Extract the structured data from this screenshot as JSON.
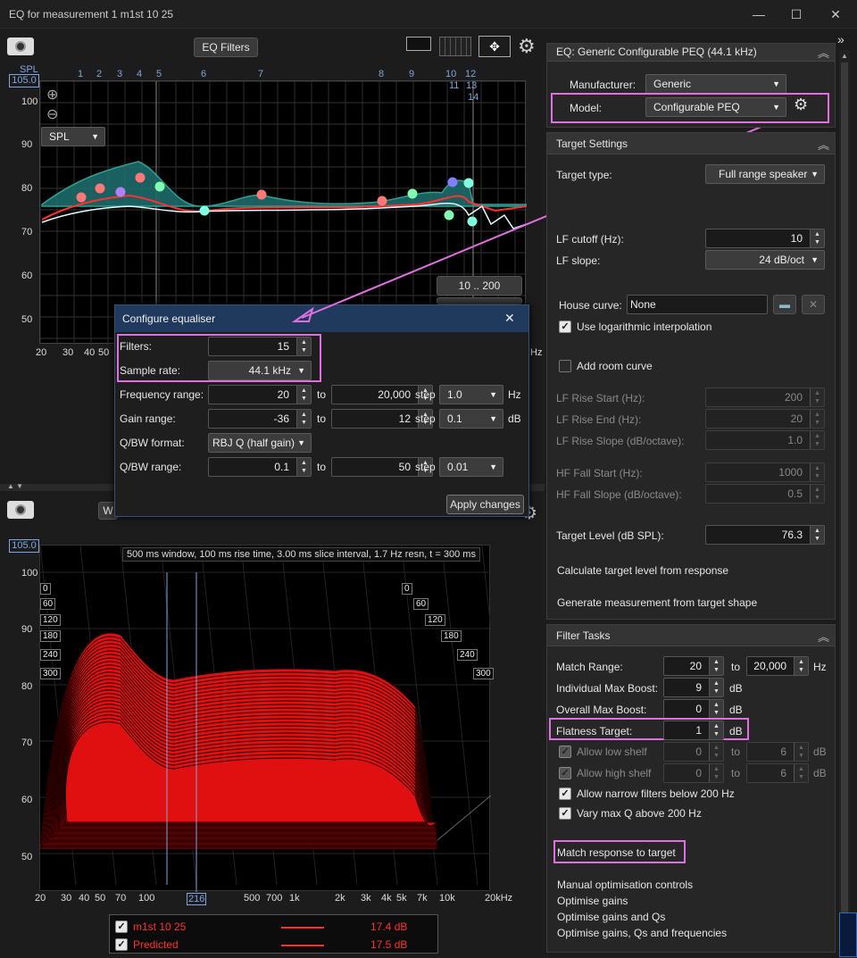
{
  "window": {
    "title": "EQ for measurement 1 m1st 10 25",
    "minimize": "—",
    "maximize": "☐",
    "close": "✕"
  },
  "top_toolbar": {
    "eq_filters_label": "EQ Filters"
  },
  "upper_chart": {
    "top_value": "105.0",
    "y_axis_label": "SPL",
    "y_ticks": [
      "100",
      "90",
      "80",
      "70",
      "60",
      "50"
    ],
    "x_ticks": [
      "20",
      "30",
      "40",
      "50"
    ],
    "filter_numbers": [
      "1",
      "2",
      "3",
      "4",
      "5",
      "6",
      "7",
      "8",
      "9",
      "10",
      "11",
      "12",
      "13",
      "14"
    ],
    "spl_combo": "SPL",
    "range_button": "10 .. 200",
    "zoom_in": "⊕",
    "zoom_out": "⊖",
    "partial_x_label": "Hz"
  },
  "dialog": {
    "title": "Configure equaliser",
    "close": "✕",
    "filters_label": "Filters:",
    "filters_value": "15",
    "sample_rate_label": "Sample rate:",
    "sample_rate_value": "44.1 kHz",
    "freq_range_label": "Frequency range:",
    "freq_from": "20",
    "freq_to": "20,000",
    "freq_step": "1.0",
    "freq_unit": "Hz",
    "gain_range_label": "Gain range:",
    "gain_from": "-36",
    "gain_to": "12",
    "gain_step": "0.1",
    "gain_unit": "dB",
    "qbw_format_label": "Q/BW format:",
    "qbw_format_value": "RBJ Q (half gain)",
    "qbw_range_label": "Q/BW range:",
    "qbw_from": "0.1",
    "qbw_to": "50",
    "qbw_step": "0.01",
    "to_label": "to",
    "step_label": "step",
    "apply_label": "Apply changes"
  },
  "lower_chart": {
    "top_value": "105.0",
    "info": "500 ms window, 100 ms rise time, 3.00 ms slice interval, 1.7 Hz resn, t = 300 ms",
    "y_ticks": [
      "100",
      "90",
      "80",
      "70",
      "60",
      "50"
    ],
    "x_ticks": [
      "20",
      "30",
      "40",
      "50",
      "70",
      "100",
      "216",
      "500",
      "700",
      "1k",
      "2k",
      "3k",
      "4k",
      "5k",
      "7k",
      "10k",
      "20kHz"
    ],
    "time_left": [
      "0",
      "60",
      "120",
      "180",
      "240",
      "300"
    ],
    "time_right": [
      "0",
      "60",
      "120",
      "180",
      "240",
      "300"
    ],
    "partial_w": "W"
  },
  "legend": {
    "rows": [
      {
        "name": "m1st 10 25",
        "value": "17.4 dB",
        "color": "#ff3030"
      },
      {
        "name": "Predicted",
        "value": "17.5 dB",
        "color": "#ff3030"
      }
    ]
  },
  "eq_panel": {
    "header": "EQ: Generic Configurable PEQ (44.1 kHz)",
    "manufacturer_label": "Manufacturer:",
    "manufacturer_value": "Generic",
    "model_label": "Model:",
    "model_value": "Configurable PEQ"
  },
  "target_settings": {
    "header": "Target Settings",
    "target_type_label": "Target type:",
    "target_type_value": "Full range speaker",
    "lf_cutoff_label": "LF cutoff (Hz):",
    "lf_cutoff_value": "10",
    "lf_slope_label": "LF slope:",
    "lf_slope_value": "24 dB/oct",
    "house_curve_label": "House curve:",
    "house_curve_value": "None",
    "log_interp_label": "Use logarithmic interpolation",
    "add_room_label": "Add room curve",
    "lf_rise_start_label": "LF Rise Start (Hz):",
    "lf_rise_start_value": "200",
    "lf_rise_end_label": "LF Rise End (Hz):",
    "lf_rise_end_value": "20",
    "lf_rise_slope_label": "LF Rise Slope (dB/octave):",
    "lf_rise_slope_value": "1.0",
    "hf_fall_start_label": "HF Fall Start (Hz):",
    "hf_fall_start_value": "1000",
    "hf_fall_slope_label": "HF Fall Slope (dB/octave):",
    "hf_fall_slope_value": "0.5",
    "target_level_label": "Target Level (dB SPL):",
    "target_level_value": "76.3",
    "calc_target_label": "Calculate target level from response",
    "gen_meas_label": "Generate measurement from target shape"
  },
  "filter_tasks": {
    "header": "Filter Tasks",
    "match_range_label": "Match Range:",
    "match_from": "20",
    "match_to": "20,000",
    "match_unit": "Hz",
    "ind_boost_label": "Individual Max Boost:",
    "ind_boost_value": "9",
    "overall_boost_label": "Overall Max Boost:",
    "overall_boost_value": "0",
    "flatness_label": "Flatness Target:",
    "flatness_value": "1",
    "db": "dB",
    "to": "to",
    "low_shelf_label": "Allow low shelf",
    "low_shelf_from": "0",
    "low_shelf_to": "6",
    "high_shelf_label": "Allow high shelf",
    "high_shelf_from": "0",
    "high_shelf_to": "6",
    "narrow_label": "Allow narrow filters below 200 Hz",
    "vary_q_label": "Vary max Q above 200 Hz",
    "match_label": "Match response to target",
    "manual_label": "Manual optimisation controls",
    "opt_gains_label": "Optimise gains",
    "opt_gains_q_label": "Optimise gains and Qs",
    "opt_all_label": "Optimise gains, Qs and frequencies"
  },
  "colors": {
    "accent": "#e070e0",
    "response": "#ff3030",
    "eq_fill": "#1f6b6b",
    "dialog_header": "#1f3a5c"
  }
}
